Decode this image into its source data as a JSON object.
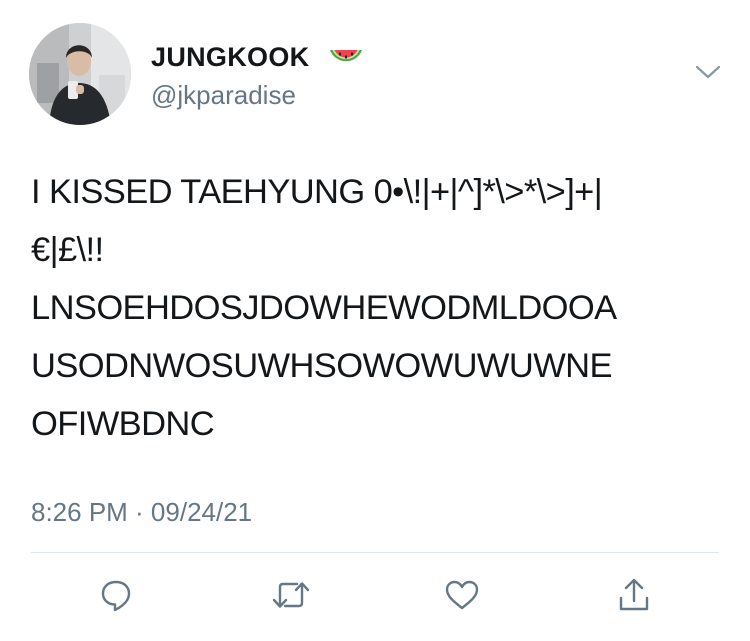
{
  "tweet": {
    "author": {
      "display_name": "JUNGKOOK",
      "name_emoji": "watermelon-icon",
      "handle": "@jkparadise"
    },
    "text_lines": [
      "I KISSED TAEHYUNG 0•\\!|+|^]*\\>*\\>]+|",
      "€|£\\!!",
      "LNSOEHDOSJDOWHEWODMLDOOA",
      "USODNWOSUWHSOWOWUWUWNE",
      "OFIWBDNC"
    ],
    "timestamp": "8:26 PM · 09/24/21",
    "menu_icon": "chevron-down-icon",
    "actions": [
      {
        "name": "reply",
        "icon": "reply-icon"
      },
      {
        "name": "retweet",
        "icon": "retweet-icon"
      },
      {
        "name": "like",
        "icon": "heart-icon"
      },
      {
        "name": "share",
        "icon": "share-icon"
      }
    ]
  },
  "colors": {
    "text": "#14171a",
    "secondary": "#657786",
    "icon": "#657786",
    "divider": "#e1e8ed"
  }
}
